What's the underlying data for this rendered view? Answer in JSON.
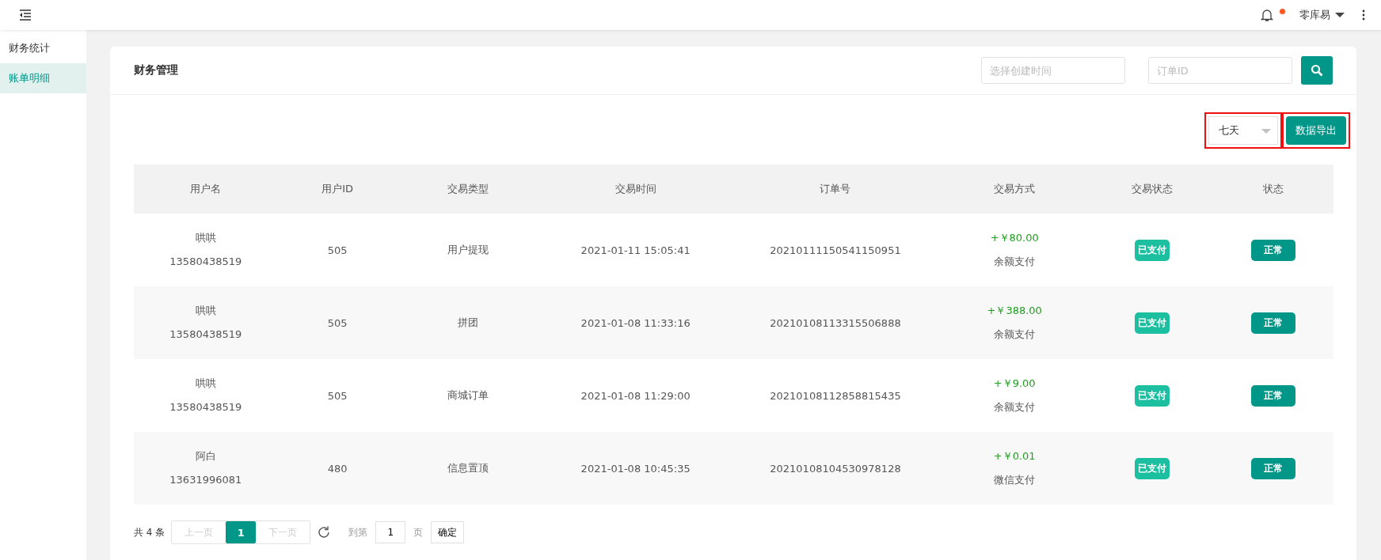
{
  "topbar": {
    "notification_dot": true,
    "user": "零库易"
  },
  "sidebar": {
    "items": [
      {
        "label": "财务统计",
        "selected": false
      },
      {
        "label": "账单明细",
        "selected": true
      }
    ]
  },
  "card": {
    "title": "财务管理",
    "date_field": {
      "placeholder": "选择创建时间"
    },
    "order_field": {
      "placeholder": "订单ID"
    },
    "period_select": {
      "value": "七天",
      "highlighted": true
    },
    "export_button": {
      "label": "数据导出",
      "highlighted": true
    }
  },
  "table": {
    "columns": [
      "用户名",
      "用户ID",
      "交易类型",
      "交易时间",
      "订单号",
      "交易方式",
      "交易状态",
      "状态"
    ],
    "rows": [
      {
        "name": "哄哄",
        "phone": "13580438519",
        "user_id": "505",
        "type": "用户提现",
        "time": "2021-01-11 15:05:41",
        "order_no": "20210111150541150951",
        "amount": "+￥80.00",
        "method": "余额支付",
        "pay_status": "已支付",
        "status": "正常"
      },
      {
        "name": "哄哄",
        "phone": "13580438519",
        "user_id": "505",
        "type": "拼团",
        "time": "2021-01-08 11:33:16",
        "order_no": "20210108113315506888",
        "amount": "+￥388.00",
        "method": "余额支付",
        "pay_status": "已支付",
        "status": "正常"
      },
      {
        "name": "哄哄",
        "phone": "13580438519",
        "user_id": "505",
        "type": "商城订单",
        "time": "2021-01-08 11:29:00",
        "order_no": "20210108112858815435",
        "amount": "+￥9.00",
        "method": "余额支付",
        "pay_status": "已支付",
        "status": "正常"
      },
      {
        "name": "阿白",
        "phone": "13631996081",
        "user_id": "480",
        "type": "信息置顶",
        "time": "2021-01-08 10:45:35",
        "order_no": "20210108104530978128",
        "amount": "+￥0.01",
        "method": "微信支付",
        "pay_status": "已支付",
        "status": "正常"
      }
    ]
  },
  "pagination": {
    "total": "共 4 条",
    "prev": {
      "label": "上一页",
      "disabled": true
    },
    "pages": [
      {
        "label": "1",
        "selected": true
      }
    ],
    "next": {
      "label": "下一页",
      "disabled": true
    },
    "goto_label": "到第",
    "goto_value": "1",
    "page_label": "页",
    "confirm": "确定"
  }
}
